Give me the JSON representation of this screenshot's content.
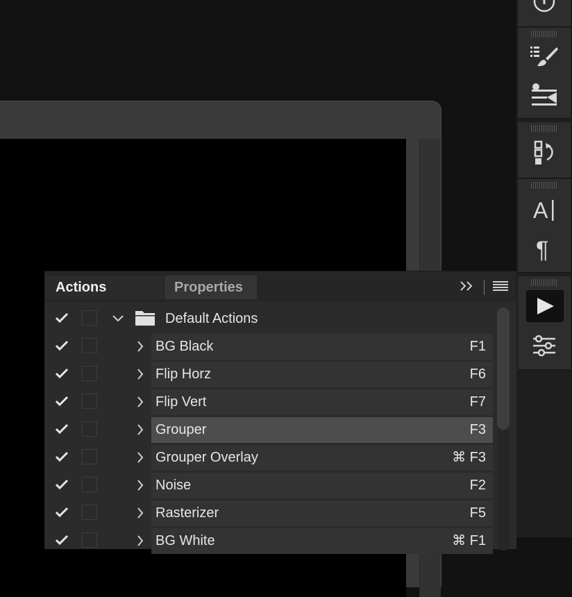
{
  "panel": {
    "tabs": [
      {
        "label": "Actions",
        "active": true
      },
      {
        "label": "Properties",
        "active": false
      }
    ],
    "expand_icon": "double-chevron-right-icon",
    "menu_icon": "hamburger-menu-icon"
  },
  "actions": {
    "folder": {
      "label": "Default Actions",
      "enabled": true,
      "expanded": true,
      "icon": "folder-icon"
    },
    "items": [
      {
        "label": "BG Black",
        "shortcut": "F1",
        "enabled": true,
        "selected": false
      },
      {
        "label": "Flip Horz",
        "shortcut": "F6",
        "enabled": true,
        "selected": false
      },
      {
        "label": "Flip Vert",
        "shortcut": "F7",
        "enabled": true,
        "selected": false
      },
      {
        "label": "Grouper",
        "shortcut": "F3",
        "enabled": true,
        "selected": true
      },
      {
        "label": "Grouper Overlay",
        "shortcut": "⌘ F3",
        "enabled": true,
        "selected": false
      },
      {
        "label": "Noise",
        "shortcut": "F2",
        "enabled": true,
        "selected": false
      },
      {
        "label": "Rasterizer",
        "shortcut": "F5",
        "enabled": true,
        "selected": false
      },
      {
        "label": "BG White",
        "shortcut": "⌘ F1",
        "enabled": true,
        "selected": false
      }
    ]
  },
  "tool_strip": {
    "buttons": [
      "info-icon",
      "brush-presets-icon",
      "clone-source-icon",
      "history-icon",
      "character-icon",
      "paragraph-icon",
      "actions-play-icon",
      "adjustments-icon"
    ],
    "active": "actions-play-icon"
  },
  "colors": {
    "background": "#121212",
    "panel": "#2b2b2b",
    "selected_row": "#4d4d4d",
    "text": "#e6e6e6"
  }
}
